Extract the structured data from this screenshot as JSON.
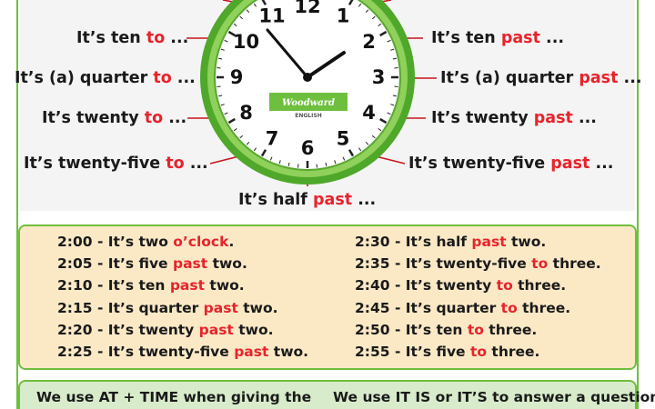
{
  "clock": {
    "numerals": [
      "12",
      "1",
      "2",
      "3",
      "4",
      "5",
      "6",
      "7",
      "8",
      "9",
      "10",
      "11"
    ],
    "logo_text": "Woodward",
    "logo_sub": "ENGLISH",
    "labels": {
      "ten_to": {
        "a": "It’s ten ",
        "b": "to",
        "c": " ..."
      },
      "quarter_to": {
        "a": "It’s (a) quarter ",
        "b": "to",
        "c": " ..."
      },
      "twenty_to": {
        "a": "It’s twenty ",
        "b": "to",
        "c": " ..."
      },
      "twentyfive_to": {
        "a": "It’s twenty-five ",
        "b": "to",
        "c": " ..."
      },
      "half_past": {
        "a": "It’s half ",
        "b": "past",
        "c": " ..."
      },
      "ten_past": {
        "a": "It’s ten ",
        "b": "past",
        "c": " ..."
      },
      "quarter_past": {
        "a": "It’s (a) quarter ",
        "b": "past",
        "c": " ..."
      },
      "twenty_past": {
        "a": "It’s twenty ",
        "b": "past",
        "c": " ..."
      },
      "twentyfive_past": {
        "a": "It’s twenty-five ",
        "b": "past",
        "c": " ..."
      }
    }
  },
  "table": {
    "left": [
      {
        "a": "2:00 - It’s two ",
        "b": "o’clock",
        "c": "."
      },
      {
        "a": "2:05 - It’s five ",
        "b": "past",
        "c": " two."
      },
      {
        "a": "2:10 - It’s ten ",
        "b": "past",
        "c": " two."
      },
      {
        "a": "2:15 - It’s quarter ",
        "b": "past",
        "c": " two."
      },
      {
        "a": "2:20 - It’s twenty ",
        "b": "past",
        "c": " two."
      },
      {
        "a": "2:25 - It’s twenty-five ",
        "b": "past",
        "c": " two."
      }
    ],
    "right": [
      {
        "a": "2:30 - It’s half ",
        "b": "past",
        "c": " two."
      },
      {
        "a": "2:35 - It’s twenty-five ",
        "b": "to",
        "c": " three."
      },
      {
        "a": "2:40 - It’s twenty ",
        "b": "to",
        "c": " three."
      },
      {
        "a": "2:45 - It’s quarter ",
        "b": "to",
        "c": " three."
      },
      {
        "a": "2:50 - It’s ten ",
        "b": "to",
        "c": " three."
      },
      {
        "a": "2:55 - It’s five ",
        "b": "to",
        "c": " three."
      }
    ]
  },
  "bottom": {
    "left": "We use AT + TIME when giving the",
    "right": "We use IT IS or IT’S to answer a question"
  },
  "colors": {
    "accent_red": "#e8232b",
    "green": "#6fbf3f",
    "table_bg": "#fbe9c6",
    "bottom_bg": "#d8eccb"
  }
}
